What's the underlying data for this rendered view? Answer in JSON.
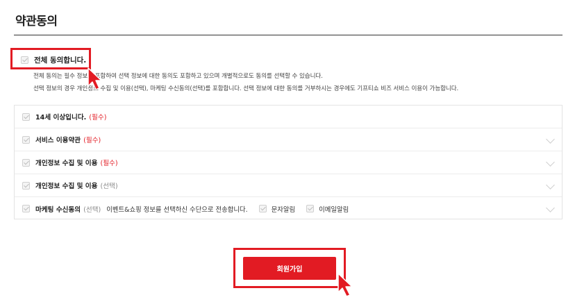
{
  "section": {
    "title": "약관동의"
  },
  "agree_all": {
    "label": "전체 동의합니다.",
    "desc_line1": "전체 동의는 필수 정보를 포함하여 선택 정보에 대한 동의도 포함하고 있으며 개별적으로도 동의를 선택할 수 있습니다.",
    "desc_line2": "선택 정보의 경우 개인정보 수집 및 이용(선택), 마케팅 수신동의(선택)를 포함합니다. 선택 정보에 대한 동의를 거부하시는 경우에도 기프티쇼 비즈 서비스 이용이 가능합니다."
  },
  "terms": [
    {
      "label": "14세 이상입니다.",
      "tag": "(필수)",
      "tag_type": "required"
    },
    {
      "label": "서비스 이용약관",
      "tag": "(필수)",
      "tag_type": "required"
    },
    {
      "label": "개인정보 수집 및 이용",
      "tag": "(필수)",
      "tag_type": "required"
    },
    {
      "label": "개인정보 수집 및 이용",
      "tag": "(선택)",
      "tag_type": "optional"
    },
    {
      "label": "마케팅 수신동의",
      "tag": "(선택)",
      "tag_type": "optional",
      "extra": "이벤트&쇼핑 정보를 선택하신 수단으로 전송합니다.",
      "channels": [
        "문자알림",
        "이메일알림"
      ]
    }
  ],
  "signup_button": {
    "label": "회원가입"
  },
  "colors": {
    "accent": "#e21b23"
  }
}
